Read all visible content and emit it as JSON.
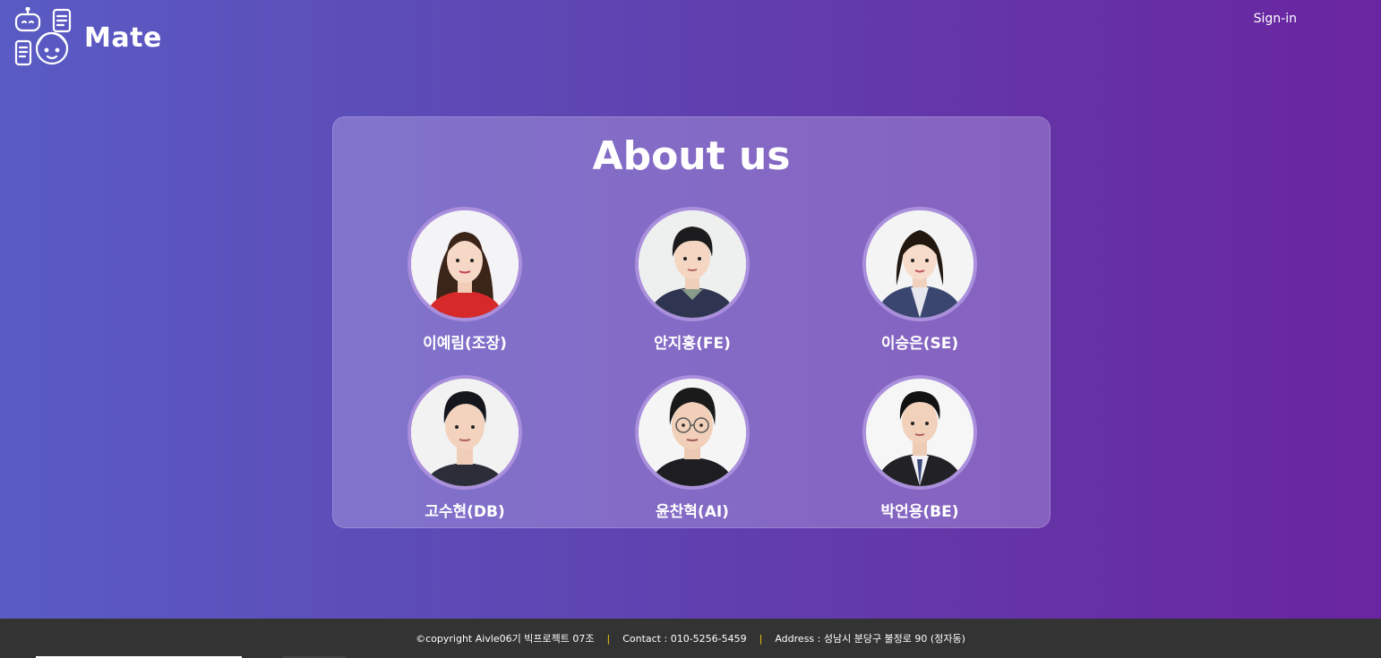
{
  "header": {
    "logo_text": "Mate",
    "signin_label": "Sign-in"
  },
  "about": {
    "title": "About us",
    "members": [
      {
        "name": "이예림(조장)",
        "hair": "#3b2418",
        "shirt": "#d62a2a",
        "hair_style": "long"
      },
      {
        "name": "안지홍(FE)",
        "hair": "#1c1c1e",
        "shirt": "#2f3550",
        "hair_style": "short"
      },
      {
        "name": "이승은(SE)",
        "hair": "#22180f",
        "shirt": "#3a4670",
        "hair_style": "bob"
      },
      {
        "name": "고수현(DB)",
        "hair": "#15161c",
        "shirt": "#2b2e38",
        "hair_style": "short"
      },
      {
        "name": "윤찬혁(AI)",
        "hair": "#1a1a1a",
        "shirt": "#1e1e22",
        "hair_style": "short"
      },
      {
        "name": "박언용(BE)",
        "hair": "#121212",
        "shirt": "#222226",
        "hair_style": "short"
      }
    ]
  },
  "footer": {
    "copyright": "©copyright Aivle06기 빅프로젝트 07조",
    "contact": "Contact : 010-5256-5459",
    "address": "Address : 성남시 분당구 불정로 90 (정자동)",
    "separator": "|"
  }
}
